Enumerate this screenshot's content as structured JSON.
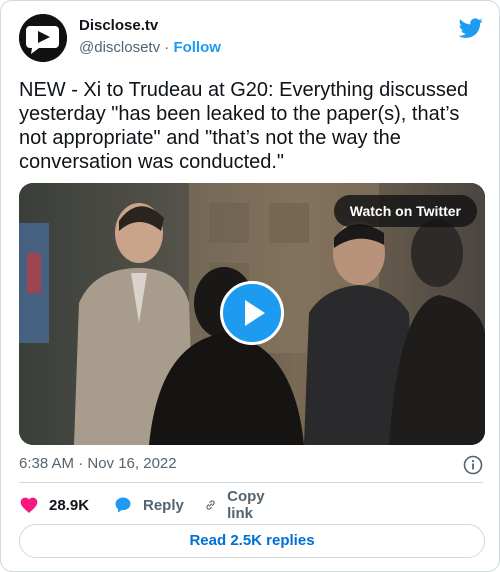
{
  "author": {
    "name": "Disclose.tv",
    "handle": "@disclosetv",
    "separator": " · ",
    "follow_label": "Follow",
    "avatar_icon": "disclose-logo",
    "platform_icon": "twitter-bird-icon"
  },
  "tweet": {
    "text": "NEW - Xi to Trudeau at G20: Everything discussed yesterday \"has been leaked to the paper(s), that’s not appropriate\" and \"that’s not the way the conversation was conducted.\""
  },
  "media": {
    "watch_label": "Watch on Twitter",
    "play_icon": "play-icon"
  },
  "meta": {
    "timestamp": "6:38 AM · Nov 16, 2022",
    "info_icon": "info-icon"
  },
  "actions": {
    "like_count": "28.9K",
    "reply_label": "Reply",
    "copy_label": "Copy link"
  },
  "read_replies_label": "Read 2.5K replies",
  "colors": {
    "accent": "#1d9bf0",
    "like": "#f91880",
    "link": "#006fd6",
    "muted": "#536471",
    "border": "#cfd9de"
  }
}
